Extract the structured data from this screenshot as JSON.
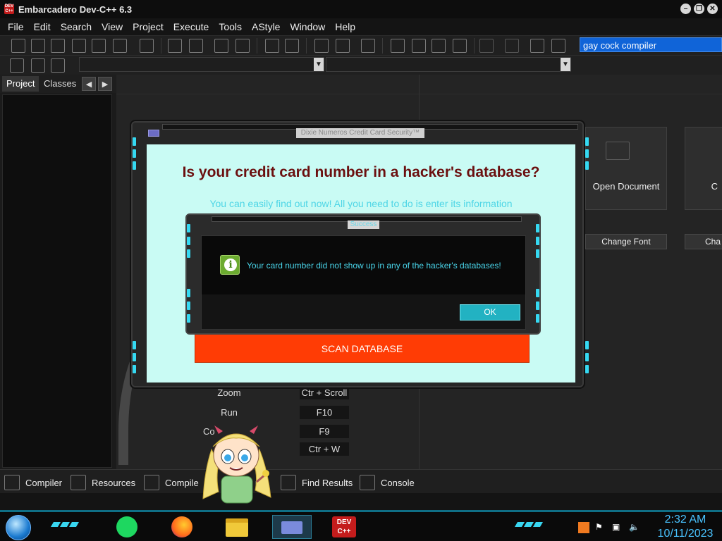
{
  "window": {
    "title": "Embarcadero Dev-C++ 6.3",
    "logo_text": "DEV C++"
  },
  "menu": [
    "File",
    "Edit",
    "Search",
    "View",
    "Project",
    "Execute",
    "Tools",
    "AStyle",
    "Window",
    "Help"
  ],
  "toolbar": {
    "search_value": "gay cock compiler"
  },
  "left_tabs": {
    "project": "Project",
    "classes": "Classes"
  },
  "welcome": {
    "open_document": "Open Document",
    "change_font": "Change Font",
    "cut_letter": "C",
    "cut_button": "Cha"
  },
  "shortcuts": [
    {
      "label": "Zoom",
      "key": "Ctr + Scroll"
    },
    {
      "label": "Run",
      "key": "F10"
    },
    {
      "label": "Co",
      "key": "F9"
    },
    {
      "label": "",
      "key": "Ctr + W"
    }
  ],
  "bottom_tabs": [
    "Compiler",
    "Resources",
    "Compile",
    "ug",
    "Find Results",
    "Console"
  ],
  "main_dialog": {
    "title": "Dixie Numeros Credit Card Security™",
    "heading": "Is your credit card number in a hacker's database?",
    "subtitle": "You can easily find out now! All you need to do is enter its information",
    "scan_button": "SCAN DATABASE"
  },
  "success_dialog": {
    "title": "Success",
    "message": "Your card number did not show up in any of the hacker's databases!",
    "ok_button": "OK"
  },
  "taskbar": {
    "time": "2:32 AM",
    "date": "10/11/2023",
    "devcpp_label": "DEV C++"
  },
  "colors": {
    "accent_cyan": "#35d9f2",
    "dialog_bg": "#c9fbf4",
    "heading_red": "#6b0f0f",
    "scan_orange": "#ff3c05",
    "search_blue": "#1064d8"
  }
}
